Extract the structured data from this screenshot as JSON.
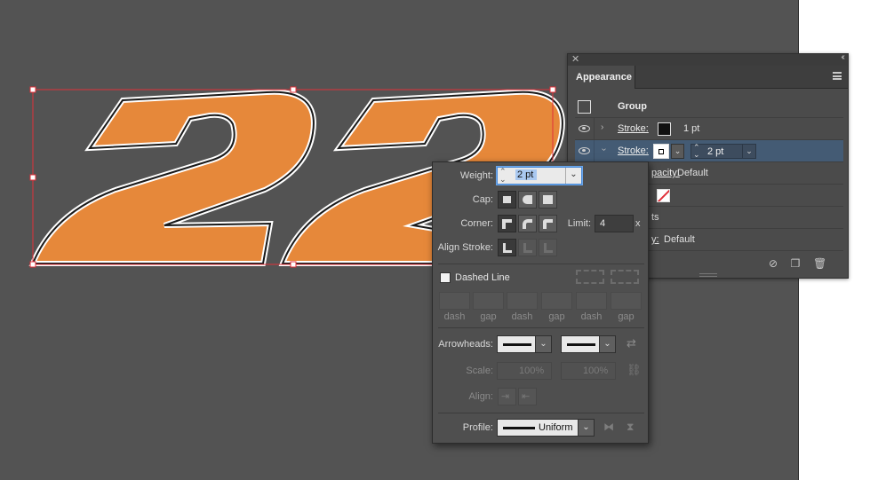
{
  "appearance": {
    "tab_title": "Appearance",
    "group_label": "Group",
    "stroke1": {
      "label": "Stroke:",
      "weight": "1 pt",
      "color": "#111111"
    },
    "stroke2": {
      "label": "Stroke:",
      "weight": "2 pt",
      "color": "#ffffff"
    },
    "opacity_label": "pacity:",
    "opacity_value": "Default",
    "effects_label": "ts",
    "opacity2_label": "y:",
    "opacity2_value": "Default"
  },
  "stroke_options": {
    "weight_label": "Weight:",
    "weight_value": "2 pt",
    "cap_label": "Cap:",
    "corner_label": "Corner:",
    "limit_label": "Limit:",
    "limit_value": "4",
    "limit_unit": "x",
    "align_label": "Align Stroke:",
    "dashed_line_label": "Dashed Line",
    "dash_labels": [
      "dash",
      "gap",
      "dash",
      "gap",
      "dash",
      "gap"
    ],
    "arrowheads_label": "Arrowheads:",
    "scale_label": "Scale:",
    "scale_value_1": "100%",
    "scale_value_2": "100%",
    "align_arrow_label": "Align:",
    "profile_label": "Profile:",
    "profile_value": "Uniform"
  },
  "artwork": {
    "text": "22",
    "fill_color": "#e6883a",
    "stroke_color": "#1a1a1a",
    "selection_color": "#e0303a"
  }
}
